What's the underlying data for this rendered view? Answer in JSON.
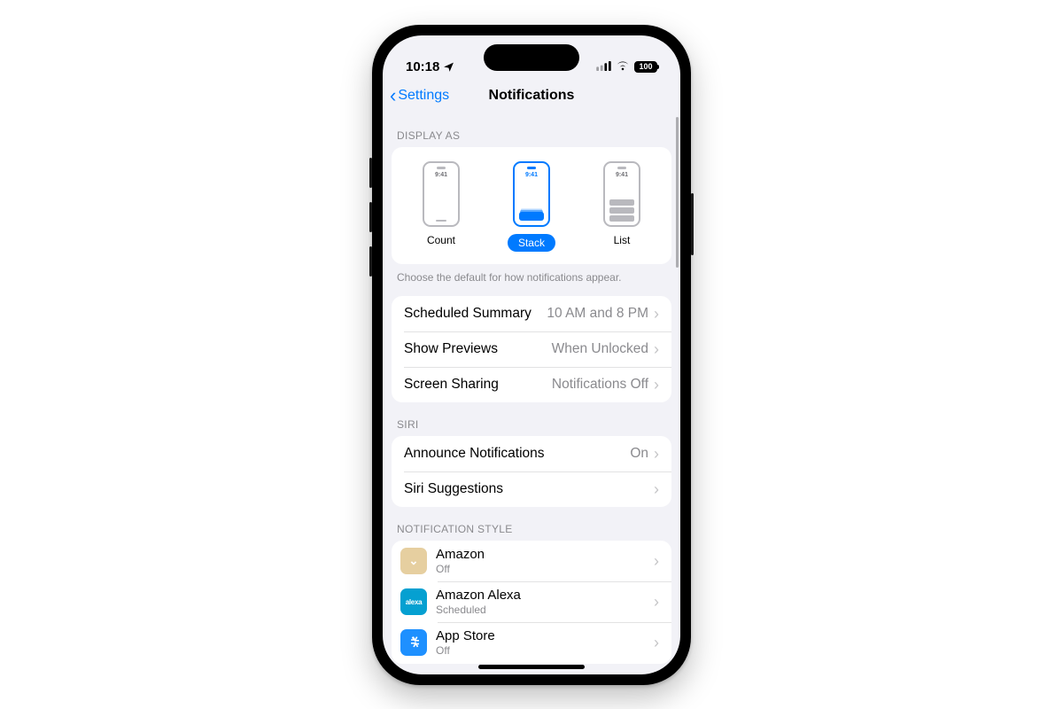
{
  "status": {
    "time": "10:18",
    "battery": "100"
  },
  "nav": {
    "back": "Settings",
    "title": "Notifications"
  },
  "display_as": {
    "header": "DISPLAY AS",
    "options": [
      {
        "label": "Count",
        "time": "9:41",
        "selected": false
      },
      {
        "label": "Stack",
        "time": "9:41",
        "selected": true
      },
      {
        "label": "List",
        "time": "9:41",
        "selected": false
      }
    ],
    "footer": "Choose the default for how notifications appear."
  },
  "settings_group": [
    {
      "label": "Scheduled Summary",
      "value": "10 AM and 8 PM"
    },
    {
      "label": "Show Previews",
      "value": "When Unlocked"
    },
    {
      "label": "Screen Sharing",
      "value": "Notifications Off"
    }
  ],
  "siri": {
    "header": "SIRI",
    "rows": [
      {
        "label": "Announce Notifications",
        "value": "On"
      },
      {
        "label": "Siri Suggestions",
        "value": ""
      }
    ]
  },
  "style": {
    "header": "NOTIFICATION STYLE",
    "apps": [
      {
        "name": "Amazon",
        "sub": "Off",
        "icon_bg": "#e6cfa0",
        "icon_text": "⬇"
      },
      {
        "name": "Amazon Alexa",
        "sub": "Scheduled",
        "icon_bg": "#05a0d1",
        "icon_text": "alexa"
      },
      {
        "name": "App Store",
        "sub": "Off",
        "icon_bg": "#1e90ff",
        "icon_text": "A"
      }
    ]
  }
}
